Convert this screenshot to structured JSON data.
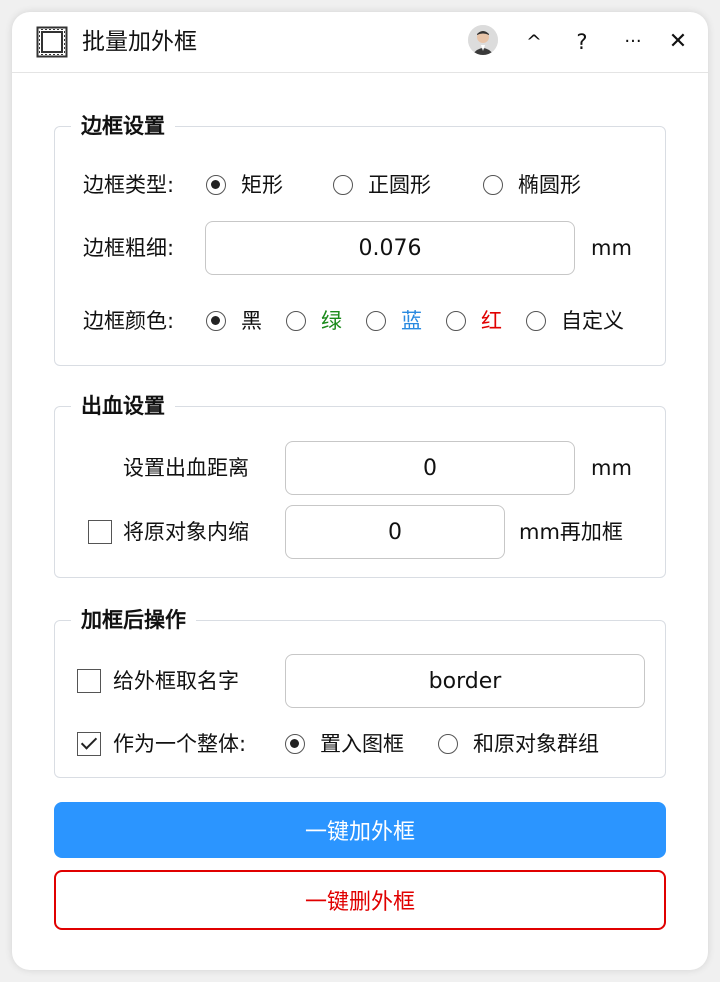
{
  "window": {
    "title": "批量加外框",
    "controls": {
      "collapse": "^",
      "help": "?",
      "more": "···",
      "close": "✕"
    }
  },
  "border_settings": {
    "title": "边框设置",
    "type_label": "边框类型:",
    "types": [
      {
        "label": "矩形",
        "selected": true
      },
      {
        "label": "正圆形",
        "selected": false
      },
      {
        "label": "椭圆形",
        "selected": false
      }
    ],
    "thickness_label": "边框粗细:",
    "thickness_value": "0.076",
    "thickness_unit": "mm",
    "color_label": "边框颜色:",
    "colors": [
      {
        "label": "黑",
        "color": "#111111",
        "selected": true
      },
      {
        "label": "绿",
        "color": "#1a8a1a",
        "selected": false
      },
      {
        "label": "蓝",
        "color": "#2a8ae0",
        "selected": false
      },
      {
        "label": "红",
        "color": "#e00000",
        "selected": false
      },
      {
        "label": "自定义",
        "color": "#111111",
        "selected": false
      }
    ]
  },
  "bleed_settings": {
    "title": "出血设置",
    "bleed_label": "设置出血距离",
    "bleed_value": "0",
    "bleed_unit": "mm",
    "shrink_label": "将原对象内缩",
    "shrink_checked": false,
    "shrink_value": "0",
    "shrink_unit": "mm再加框"
  },
  "post_actions": {
    "title": "加框后操作",
    "name_label": "给外框取名字",
    "name_checked": false,
    "name_value": "border",
    "whole_label": "作为一个整体:",
    "whole_checked": true,
    "whole_options": [
      {
        "label": "置入图框",
        "selected": true
      },
      {
        "label": "和原对象群组",
        "selected": false
      }
    ]
  },
  "actions": {
    "add_label": "一键加外框",
    "delete_label": "一键删外框",
    "primary_color": "#2b95ff",
    "danger_color": "#e00000"
  }
}
